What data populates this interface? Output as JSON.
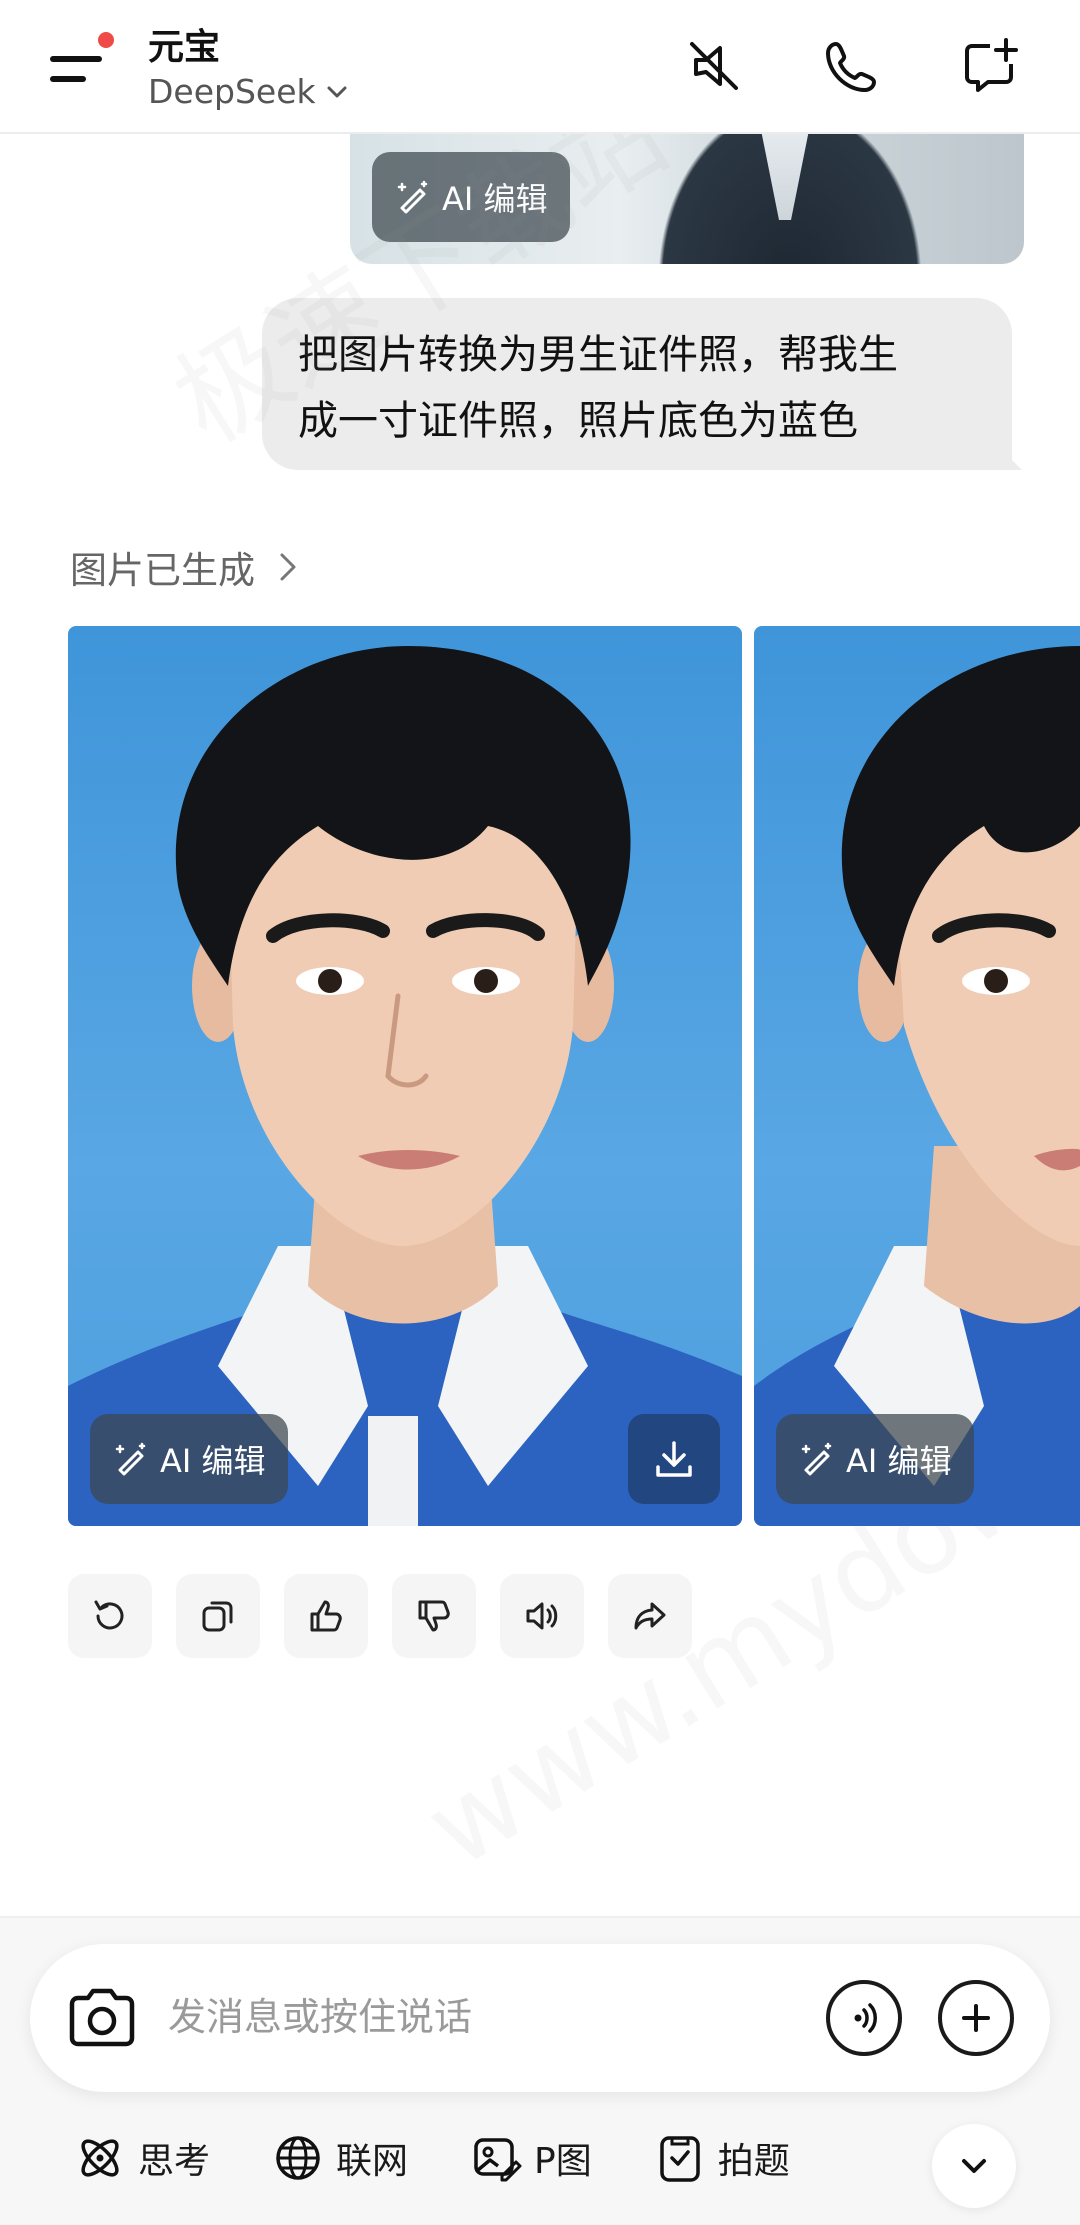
{
  "header": {
    "app_title": "元宝",
    "model_name": "DeepSeek",
    "icons": [
      "menu-icon",
      "mute-icon",
      "phone-icon",
      "new-chat-icon"
    ]
  },
  "sent_image": {
    "ai_edit_label": "AI 编辑"
  },
  "user_message": {
    "text_line1": "把图片转换为男生证件照，帮我生",
    "text_line2": "成一寸证件照，照片底色为蓝色"
  },
  "response": {
    "status_label": "图片已生成",
    "images": [
      {
        "ai_edit_label": "AI 编辑",
        "background": "#4a9ee0"
      },
      {
        "ai_edit_label": "AI 编辑",
        "background": "#4a9ee0"
      }
    ],
    "actions": [
      "refresh-icon",
      "copy-icon",
      "thumbs-up-icon",
      "thumbs-down-icon",
      "speaker-icon",
      "share-icon"
    ]
  },
  "watermark": {
    "line1": "极速下载站",
    "line2": "www.mydown.com"
  },
  "composer": {
    "placeholder": "发消息或按住说话"
  },
  "toolbar": {
    "think": "思考",
    "web": "联网",
    "p_image": "P图",
    "photo_question": "拍题"
  },
  "colors": {
    "accent_red": "#f04a48",
    "photo_blue": "#4a9ee0",
    "bubble_gray": "#ececec"
  }
}
